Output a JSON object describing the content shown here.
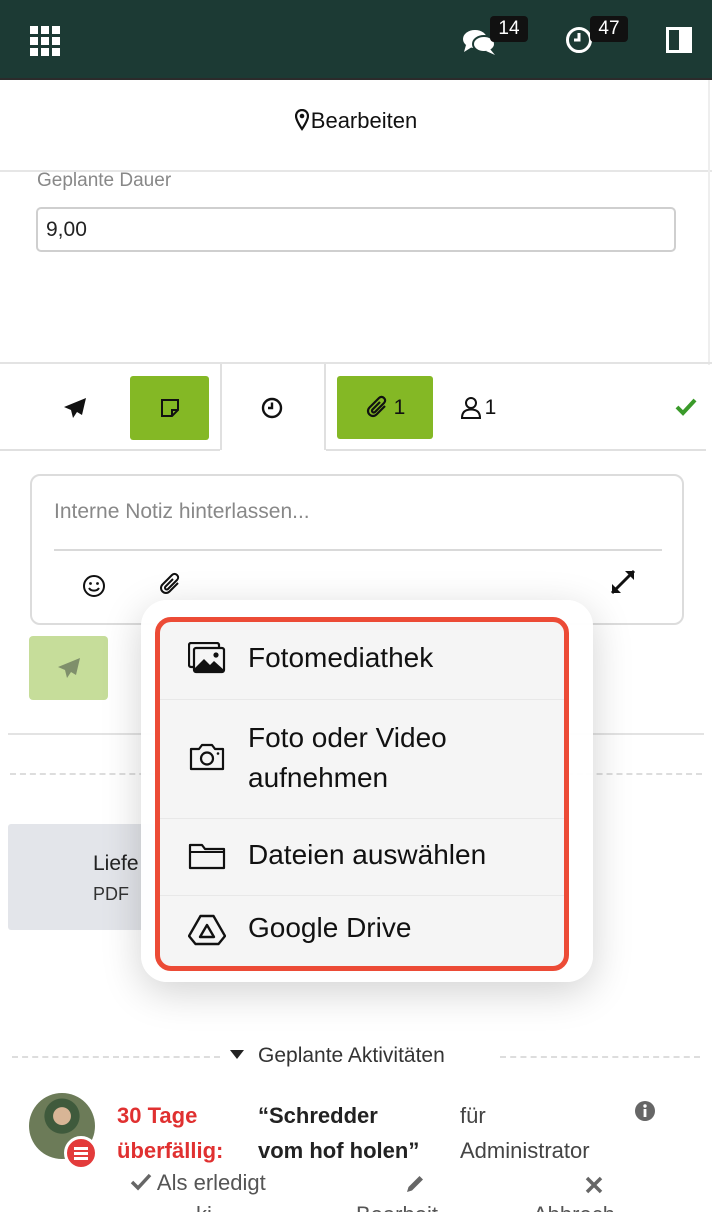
{
  "topbar": {
    "apps_icon": "apps-grid-icon",
    "messages_count": "14",
    "activities_count": "47",
    "messages_icon": "chat-bubbles-icon",
    "activities_icon": "clock-icon",
    "panel_icon": "sidebar-toggle-icon",
    "background": "#1c3a34"
  },
  "header": {
    "title": "Bearbeiten",
    "icon": "map-marker-icon"
  },
  "form": {
    "duration_label": "Geplante Dauer",
    "duration_value": "9,00"
  },
  "chatter_tabs": {
    "send_message_icon": "paper-plane-icon",
    "log_note_icon": "sticky-note-icon",
    "activity_icon": "clock-icon",
    "attachments_icon": "paperclip-icon",
    "attachments_count": "1",
    "followers_icon": "user-icon",
    "followers_count": "1",
    "follow_icon": "check-icon",
    "accent": "#84b825"
  },
  "composer": {
    "placeholder": "Interne Notiz hinterlassen...",
    "emoji_icon": "smile-icon",
    "attach_icon": "paperclip-icon",
    "expand_icon": "expand-icon",
    "send_icon": "paper-plane-icon"
  },
  "attachment": {
    "name": "Liefe",
    "type": "PDF"
  },
  "upload_menu": {
    "highlight": "#ec4b36",
    "items": [
      {
        "label": "Fotomediathek",
        "icon": "photo-library-icon"
      },
      {
        "label": "Foto oder Video",
        "label2": "aufnehmen",
        "icon": "camera-icon"
      },
      {
        "label": "Dateien auswählen",
        "icon": "folder-icon"
      },
      {
        "label": "Google Drive",
        "icon": "google-drive-icon"
      }
    ]
  },
  "activities": {
    "heading": "Geplante Aktivitäten",
    "item": {
      "overdue_line1": "30 Tage",
      "overdue_line2": "überfällig:",
      "title_line1": "“Schredder",
      "title_line2": "vom hof holen”",
      "for_line1": "für",
      "for_line2": "Administrator",
      "info_icon": "info-icon",
      "actions": {
        "done": "Als erledigt",
        "done_icon": "check-icon",
        "edit_icon": "pencil-icon",
        "cancel_icon": "x-icon",
        "done_cont": "ki",
        "edit_cont": "Bearbeit",
        "cancel_cont": "Abbrech"
      }
    }
  }
}
